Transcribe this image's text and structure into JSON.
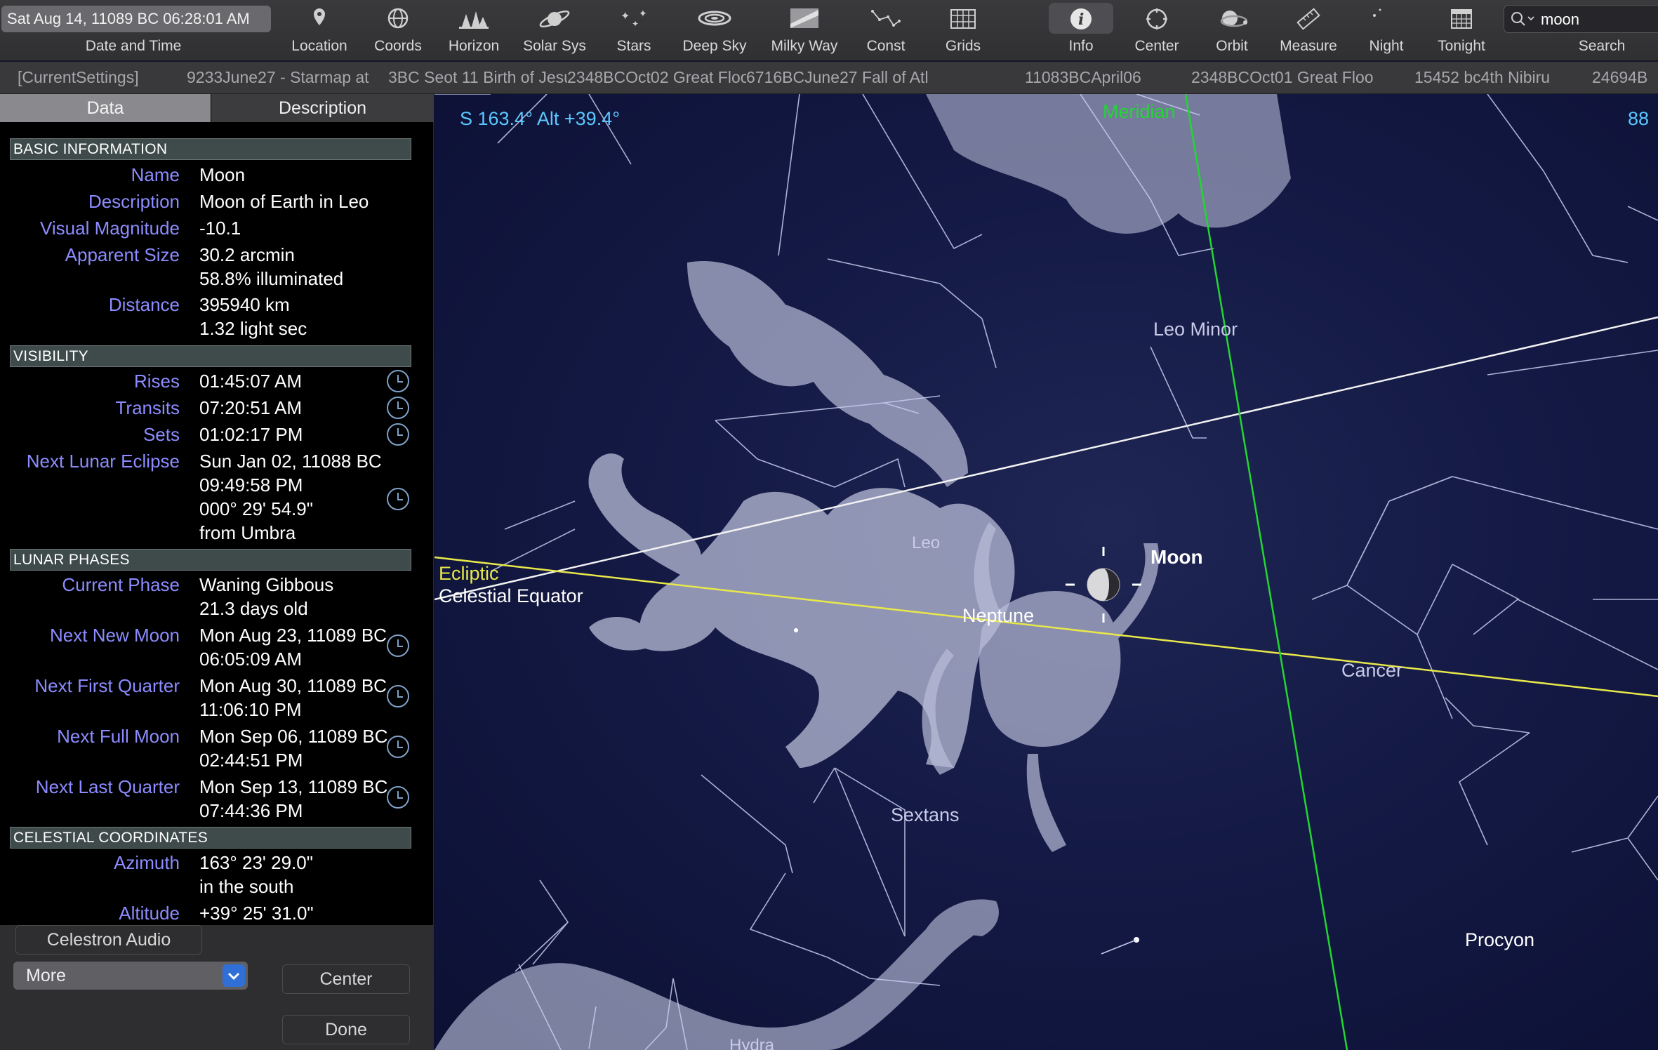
{
  "toolbar": {
    "date_time": "Sat Aug 14, 11089 BC 06:28:01 AM",
    "date_time_label": "Date and Time",
    "items": [
      {
        "label": "Location"
      },
      {
        "label": "Coords"
      },
      {
        "label": "Horizon"
      },
      {
        "label": "Solar Sys"
      },
      {
        "label": "Stars"
      },
      {
        "label": "Deep Sky"
      },
      {
        "label": "Milky Way"
      },
      {
        "label": "Const"
      },
      {
        "label": "Grids"
      },
      {
        "label": "Info"
      },
      {
        "label": "Center"
      },
      {
        "label": "Orbit"
      },
      {
        "label": "Measure"
      },
      {
        "label": "Night"
      },
      {
        "label": "Tonight"
      },
      {
        "label": "Search"
      }
    ],
    "search_value": "moon"
  },
  "bookmarks": [
    "[CurrentSettings]",
    "9233June27 - Starmap at",
    "3BC Seot 11 Birth of Jesu",
    "2348BCOct02 Great Floo",
    "6716BCJune27 Fall of Atl",
    "11083BCApril06",
    "2348BCOct01 Great Floo",
    "15452 bc4th Nibiru",
    "24694B"
  ],
  "panel": {
    "tabs": {
      "data": "Data",
      "description": "Description"
    },
    "basic": {
      "header": "BASIC INFORMATION",
      "name_label": "Name",
      "name": "Moon",
      "description_label": "Description",
      "description": "Moon of Earth in Leo",
      "magnitude_label": "Visual Magnitude",
      "magnitude": "-10.1",
      "size_label": "Apparent Size",
      "size": "30.2 arcmin",
      "illuminated": "58.8% illuminated",
      "distance_label": "Distance",
      "distance_km": "395940 km",
      "distance_light": "1.32 light sec"
    },
    "visibility": {
      "header": "VISIBILITY",
      "rises_label": "Rises",
      "rises": "01:45:07 AM",
      "transits_label": "Transits",
      "transits": "07:20:51 AM",
      "sets_label": "Sets",
      "sets": "01:02:17 PM",
      "eclipse_label": "Next Lunar Eclipse",
      "eclipse_date": "Sun Jan 02, 11088 BC",
      "eclipse_time": "09:49:58 PM",
      "eclipse_angle": "000° 29' 54.9\"",
      "eclipse_from": "from Umbra"
    },
    "phases": {
      "header": "LUNAR PHASES",
      "current_label": "Current Phase",
      "current": "Waning Gibbous",
      "age": "21.3 days old",
      "new_label": "Next New Moon",
      "new_date": "Mon Aug 23, 11089 BC",
      "new_time": "06:05:09 AM",
      "first_label": "Next First Quarter",
      "first_date": "Mon Aug 30, 11089 BC",
      "first_time": "11:06:10 PM",
      "full_label": "Next Full Moon",
      "full_date": "Mon Sep 06, 11089 BC",
      "full_time": "02:44:51 PM",
      "last_label": "Next Last Quarter",
      "last_date": "Mon Sep 13, 11089 BC",
      "last_time": "07:44:36 PM"
    },
    "coords": {
      "header": "CELESTIAL COORDINATES",
      "azimuth_label": "Azimuth",
      "azimuth": "163° 23' 29.0\"",
      "azimuth_dir": "in the south",
      "altitude_label": "Altitude",
      "altitude": "+39° 25' 31.0\""
    },
    "buttons": {
      "celestron": "Celestron Audio",
      "more": "More",
      "center": "Center",
      "done": "Done"
    }
  },
  "sky": {
    "pointing": "S 163.4° Alt +39.4°",
    "fov": "88",
    "labels": {
      "meridian": "Meridian",
      "ecliptic": "Ecliptic",
      "equator": "Celestial Equator",
      "leo_minor": "Leo Minor",
      "leo": "Leo",
      "moon": "Moon",
      "neptune": "Neptune",
      "cancer": "Cancer",
      "sextans": "Sextans",
      "procyon": "Procyon",
      "hydra": "Hydra"
    },
    "colors": {
      "meridian": "#22d633",
      "ecliptic": "#e8e84a",
      "equator": "#ffffff",
      "pointing": "#5cc8ff",
      "label_accent": "#8c8cff"
    }
  }
}
